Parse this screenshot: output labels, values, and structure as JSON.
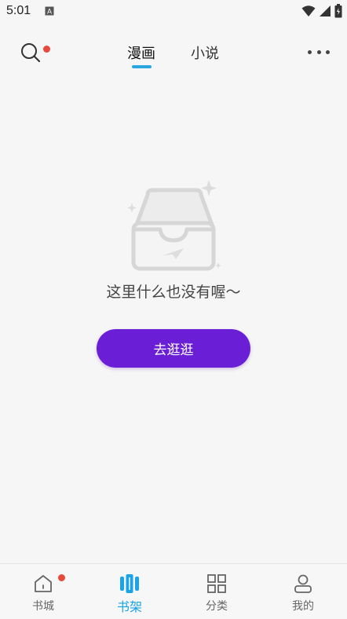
{
  "status_bar": {
    "time": "5:01",
    "icons": [
      "a-notification-icon",
      "wifi-icon",
      "signal-icon",
      "battery-icon"
    ]
  },
  "header": {
    "tabs": [
      {
        "label": "漫画",
        "active": true
      },
      {
        "label": "小说",
        "active": false
      }
    ],
    "search_icon": "search-icon",
    "more_icon": "more-dots-icon"
  },
  "empty_state": {
    "icon": "empty-inbox-icon",
    "message": "这里什么也没有喔～",
    "button_label": "去逛逛"
  },
  "bottom_nav": {
    "items": [
      {
        "label": "书城",
        "icon": "home-icon",
        "active": false,
        "badge": true
      },
      {
        "label": "书架",
        "icon": "bookshelf-icon",
        "active": true,
        "badge": false
      },
      {
        "label": "分类",
        "icon": "category-grid-icon",
        "active": false,
        "badge": false
      },
      {
        "label": "我的",
        "icon": "profile-icon",
        "active": false,
        "badge": false
      }
    ]
  },
  "colors": {
    "accent": "#1ba3e8",
    "button": "#6a1fd6",
    "badge": "#e64a3c",
    "background": "#f6f6f6"
  }
}
